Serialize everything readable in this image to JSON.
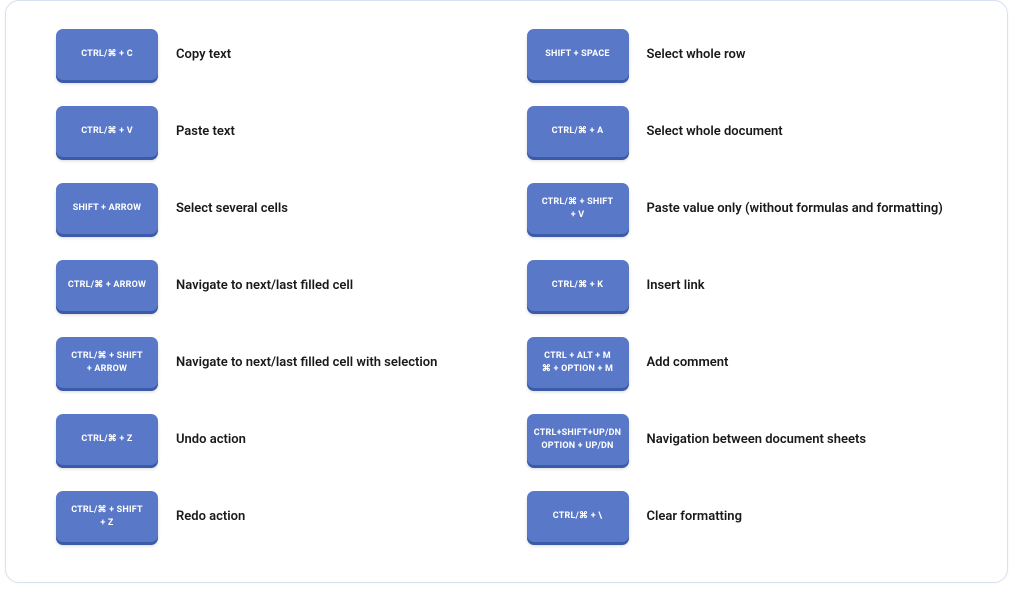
{
  "shortcuts": {
    "left": [
      {
        "key_lines": [
          "CTRL/⌘ + C"
        ],
        "desc": "Copy text"
      },
      {
        "key_lines": [
          "CTRL/⌘ + V"
        ],
        "desc": "Paste text"
      },
      {
        "key_lines": [
          "SHIFT + ARROW"
        ],
        "desc": "Select several cells"
      },
      {
        "key_lines": [
          "CTRL/⌘ + ARROW"
        ],
        "desc": "Navigate to next/last filled cell"
      },
      {
        "key_lines": [
          "CTRL/⌘ + SHIFT",
          "+ ARROW"
        ],
        "desc": "Navigate to next/last filled cell with selection"
      },
      {
        "key_lines": [
          "CTRL/⌘ + Z"
        ],
        "desc": "Undo action"
      },
      {
        "key_lines": [
          "CTRL/⌘ + SHIFT",
          "+ Z"
        ],
        "desc": "Redo action"
      }
    ],
    "right": [
      {
        "key_lines": [
          "SHIFT + SPACE"
        ],
        "desc": "Select whole row"
      },
      {
        "key_lines": [
          "CTRL/⌘ + A"
        ],
        "desc": "Select whole document"
      },
      {
        "key_lines": [
          "CTRL/⌘ + SHIFT",
          "+ V"
        ],
        "desc": "Paste value only (without formulas and formatting)"
      },
      {
        "key_lines": [
          "CTRL/⌘ + K"
        ],
        "desc": "Insert link"
      },
      {
        "key_lines": [
          "CTRL + ALT + M",
          "⌘ + OPTION + M"
        ],
        "desc": "Add comment"
      },
      {
        "key_lines": [
          "CTRL+SHIFT+UP/DN",
          "OPTION + UP/DN"
        ],
        "desc": "Navigation between document sheets"
      },
      {
        "key_lines": [
          "CTRL/⌘ + \\"
        ],
        "desc": "Clear formatting"
      }
    ]
  }
}
